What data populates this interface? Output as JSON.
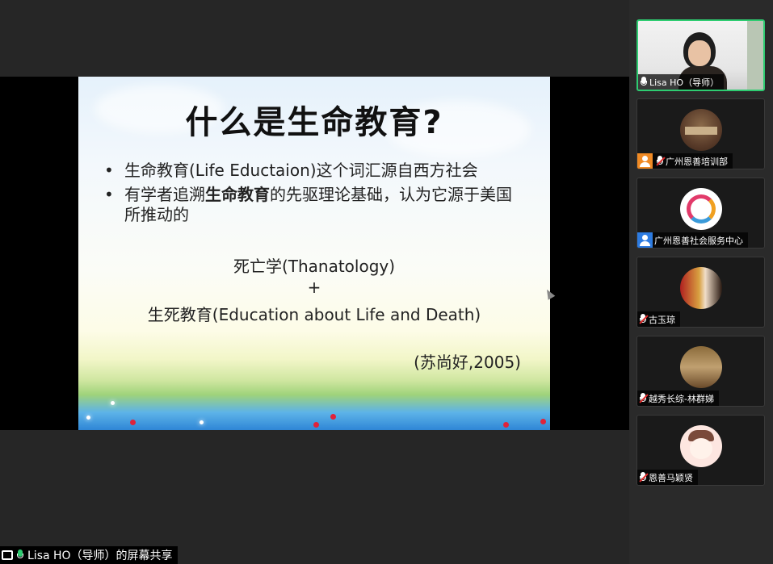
{
  "slide": {
    "title": "什么是生命教育?",
    "bullet_symbol": "•",
    "bullets": [
      {
        "text": "生命教育(Life Eductaion)这个词汇源自西方社会"
      },
      {
        "text_before": "有学者追溯",
        "text_bold": "生命教育",
        "text_after": "的先驱理论基础，认为它源于美国所推动的"
      }
    ],
    "line_thanatology": "死亡学(Thanatology)",
    "line_plus": "+",
    "line_life_death": "生死教育(Education about Life and Death)",
    "citation": "(苏尚好,2005)"
  },
  "participants": [
    {
      "name": "Lisa HO（导师）",
      "mic": "on",
      "active_speaker": true,
      "video": true
    },
    {
      "name": "广州恩善培训部",
      "mic": "muted",
      "badge": "host"
    },
    {
      "name": "广州恩善社会服务中心",
      "mic": "none",
      "badge": "user"
    },
    {
      "name": "古玉琼",
      "mic": "muted"
    },
    {
      "name": "越秀长综-林群娣",
      "mic": "muted"
    },
    {
      "name": "恩善马颖贤",
      "mic": "muted"
    }
  ],
  "share_label": "Lisa HO（导师）的屏幕共享",
  "colors": {
    "active_border": "#2ecc71",
    "host_badge": "#f08a24",
    "user_badge": "#2d7be0",
    "muted_mic": "#e02b2b"
  },
  "icons": [
    "share-screen-icon",
    "microphone-icon",
    "microphone-muted-icon",
    "host-badge-icon",
    "user-badge-icon"
  ]
}
